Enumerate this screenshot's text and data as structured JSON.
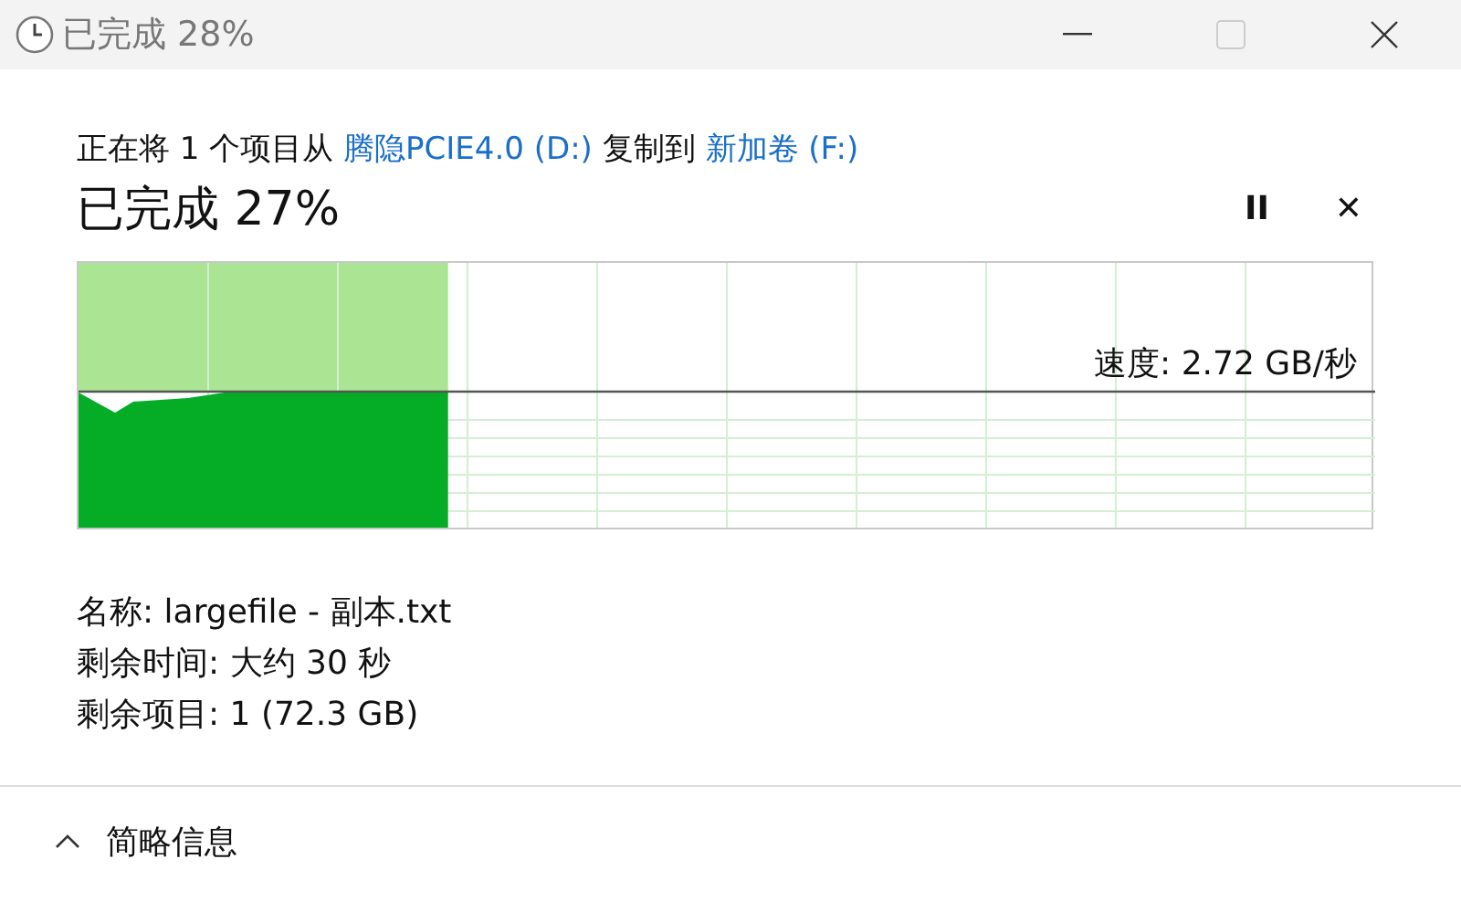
{
  "window": {
    "title": "已完成 28%",
    "maximize_disabled": true
  },
  "copy_line": {
    "prefix": "正在将 1 个项目从 ",
    "source": "腾隐PCIE4.0 (D:)",
    "middle": " 复制到 ",
    "destination": "新加卷 (F:)"
  },
  "heading": "已完成 27%",
  "pause_symbol": "II",
  "cancel_symbol": "✕",
  "graph": {
    "level": 0.285,
    "speed": "速度: 2.72 GB/秒"
  },
  "details": [
    {
      "label": "名称:",
      "value": "largefile - 副本.txt"
    },
    {
      "label": "剩余时间:",
      "value": "大约 30 秒"
    },
    {
      "label": "剩余项目:",
      "value": "1 (72.3 GB)"
    }
  ],
  "footer": {
    "toggle": "简略信息",
    "expanded": true
  }
}
